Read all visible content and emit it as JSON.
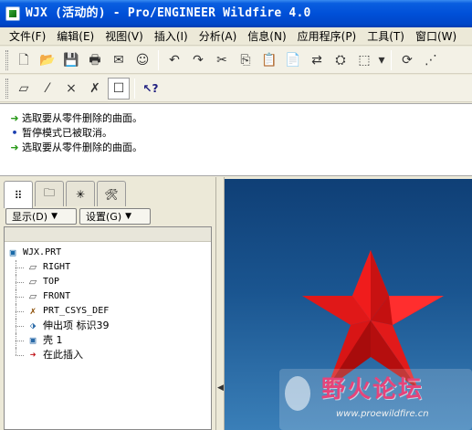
{
  "window": {
    "title": "WJX (活动的) - Pro/ENGINEER Wildfire 4.0"
  },
  "menu": [
    {
      "label": "文件(F)"
    },
    {
      "label": "编辑(E)"
    },
    {
      "label": "视图(V)"
    },
    {
      "label": "插入(I)"
    },
    {
      "label": "分析(A)"
    },
    {
      "label": "信息(N)"
    },
    {
      "label": "应用程序(P)"
    },
    {
      "label": "工具(T)"
    },
    {
      "label": "窗口(W)"
    }
  ],
  "toolbar1": [
    {
      "name": "new-icon",
      "glyph": "🗋"
    },
    {
      "name": "open-icon",
      "glyph": "📂"
    },
    {
      "name": "save-icon",
      "glyph": "💾"
    },
    {
      "name": "print-icon",
      "glyph": "🖶"
    },
    {
      "name": "send-mail-icon",
      "glyph": "✉"
    },
    {
      "name": "collaborate-icon",
      "glyph": "☺"
    },
    {
      "name": "undo-icon",
      "glyph": "↶"
    },
    {
      "name": "redo-icon",
      "glyph": "↷"
    },
    {
      "name": "cut-icon",
      "glyph": "✂"
    },
    {
      "name": "copy-icon",
      "glyph": "⎘"
    },
    {
      "name": "paste-icon",
      "glyph": "📋"
    },
    {
      "name": "paste-special-icon",
      "glyph": "📄"
    },
    {
      "name": "regenerate-icon",
      "glyph": "⇄"
    },
    {
      "name": "search-binoculars-icon",
      "glyph": "⛭"
    },
    {
      "name": "selection-box-icon",
      "glyph": "⬚"
    },
    {
      "name": "dropdown-arrow-icon",
      "glyph": "▾"
    },
    {
      "name": "repaint-icon",
      "glyph": "⟳"
    },
    {
      "name": "datum-icon",
      "glyph": "⋰"
    }
  ],
  "toolbar2": [
    {
      "name": "datum-plane-display-icon",
      "glyph": "▱"
    },
    {
      "name": "datum-axis-display-icon",
      "glyph": "⁄"
    },
    {
      "name": "datum-point-display-icon",
      "glyph": "×"
    },
    {
      "name": "coordinate-system-display-icon",
      "glyph": "✗"
    },
    {
      "name": "annotation-display-icon",
      "glyph": "☐"
    },
    {
      "name": "context-help-icon",
      "glyph": "↖?"
    }
  ],
  "messages": [
    {
      "icon": "arrow",
      "text": "选取要从零件删除的曲面。"
    },
    {
      "icon": "dot",
      "text": "暂停模式已被取消。"
    },
    {
      "icon": "arrow",
      "text": "选取要从零件删除的曲面。"
    }
  ],
  "nav_tabs": [
    {
      "name": "model-tree-tab-icon",
      "glyph": "⠿"
    },
    {
      "name": "folder-browser-tab-icon",
      "glyph": "🗀"
    },
    {
      "name": "favorites-tab-icon",
      "glyph": "✳"
    },
    {
      "name": "connections-tab-icon",
      "glyph": "🛠"
    }
  ],
  "tree_controls": {
    "show_label": "显示(D)",
    "settings_label": "设置(G)"
  },
  "tree": {
    "root": "WJX.PRT",
    "items": [
      {
        "icon": "plane",
        "glyph": "▱",
        "label": "RIGHT"
      },
      {
        "icon": "plane",
        "glyph": "▱",
        "label": "TOP"
      },
      {
        "icon": "plane",
        "glyph": "▱",
        "label": "FRONT"
      },
      {
        "icon": "csys",
        "glyph": "✗",
        "label": "PRT_CSYS_DEF"
      },
      {
        "icon": "ext",
        "glyph": "⬗",
        "label": "伸出项 标识39"
      },
      {
        "icon": "shell",
        "glyph": "▣",
        "label": "壳 1"
      },
      {
        "icon": "insert",
        "glyph": "➜",
        "label": "在此插入"
      }
    ]
  },
  "watermark": {
    "title": "野火论坛",
    "url": "www.proewildfire.cn"
  }
}
